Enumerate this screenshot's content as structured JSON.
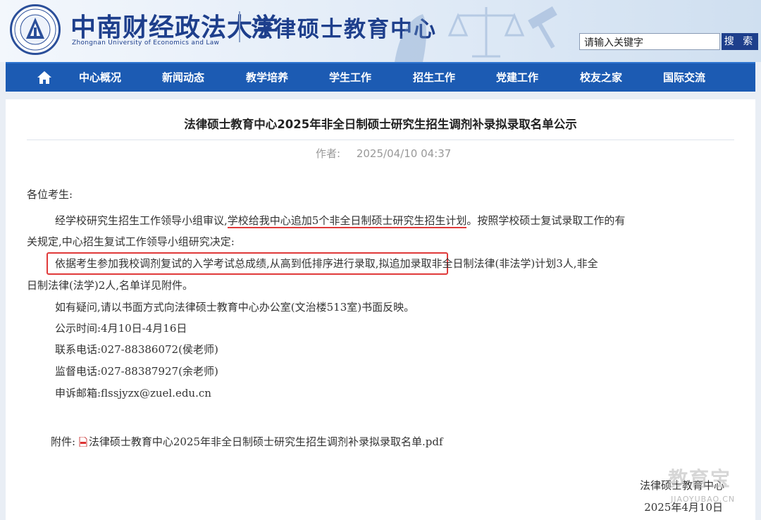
{
  "header": {
    "logo_cn": "中南财经政法大学",
    "logo_en": "Zhongnan University of Economics and Law",
    "center_name": "法律硕士教育中心",
    "search_placeholder": "请输入关键字",
    "search_button": "搜 索"
  },
  "nav": {
    "home_icon": "home-icon",
    "items": [
      "中心概况",
      "新闻动态",
      "教学培养",
      "学生工作",
      "招生工作",
      "党建工作",
      "校友之家",
      "国际交流"
    ]
  },
  "article": {
    "title": "法律硕士教育中心2025年非全日制硕士研究生招生调剂补录拟录取名单公示",
    "author_label": "作者:",
    "date": "2025/04/10 04:37",
    "greeting": "各位考生:",
    "p1_a": "经学校研究生招生工作领导小组审议,",
    "p1_b": "学校给我中心追加5个非全日制硕士研究生招生计划",
    "p1_c": "。按照学校硕士复试录取工作的有",
    "p1_d": "关规定,中心招生复试工作领导小组研究决定:",
    "p2_a": "依据考生参加我校调剂复试的入学考试总成绩,从高到低排序进行录取,",
    "p2_b": "拟追加录取非全日制法律(非法学)计划3人,非全",
    "p2_c": "日制法律(法学)2人,名单详见附件。",
    "p3": "如有疑问,请以书面方式向法律硕士教育中心办公室(文治楼513室)书面反映。",
    "p4": "公示时间:4月10日-4月16日",
    "p5": "联系电话:027-88386072(侯老师)",
    "p6": "监督电话:027-88387927(余老师)",
    "p7": "申诉邮箱:flssjyzx@zuel.edu.cn",
    "attachment_label": "附件:",
    "attachment_name": "法律硕士教育中心2025年非全日制硕士研究生招生调剂补录拟录取名单.pdf",
    "sign_org": "法律硕士教育中心",
    "sign_date": "2025年4月10日"
  },
  "watermark": {
    "text": "教育宝",
    "sub": "JIAOYUBAO.CN"
  },
  "colors": {
    "brand_blue": "#1e3f8c",
    "nav_blue": "#1c5bb3",
    "highlight_red": "#e03a3a"
  }
}
